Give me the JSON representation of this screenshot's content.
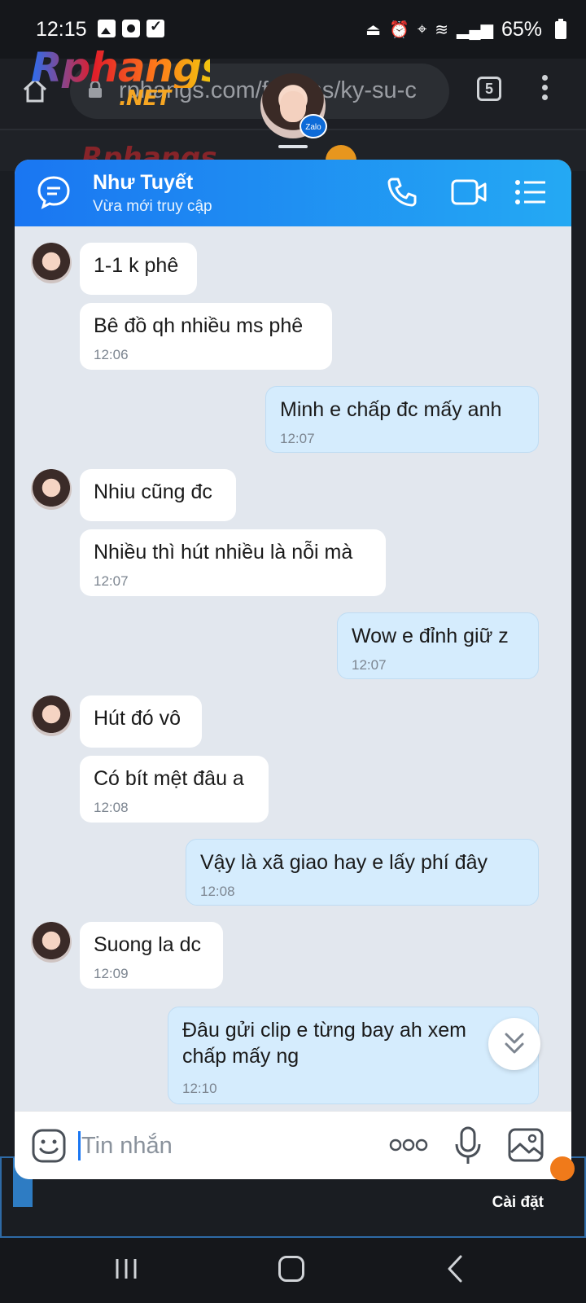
{
  "status_bar": {
    "time": "12:15",
    "battery": "65%"
  },
  "browser": {
    "url_visible": "rphangs.com/forums/ky-su-c",
    "tab_count": "5",
    "site_logo": "Rphangs",
    "site_logo_suffix": ".NET"
  },
  "chat": {
    "contact_name": "Như Tuyết",
    "contact_status": "Vừa mới truy cập",
    "badge": "Zalo",
    "messages": [
      {
        "dir": "in",
        "text": "1-1 k phê",
        "time": ""
      },
      {
        "dir": "in",
        "text": "Bê đồ qh nhiều ms phê",
        "time": "12:06"
      },
      {
        "dir": "out",
        "text": "Minh e chấp đc mấy  anh",
        "time": "12:07"
      },
      {
        "dir": "in",
        "text": "Nhiu cũng đc",
        "time": ""
      },
      {
        "dir": "in",
        "text": "Nhiều thì hút nhiều là nỗi mà",
        "time": "12:07"
      },
      {
        "dir": "out",
        "text": "Wow e đỉnh giữ  z",
        "time": "12:07"
      },
      {
        "dir": "in",
        "text": "Hút đó vô",
        "time": ""
      },
      {
        "dir": "in",
        "text": "Có bít mệt đâu a",
        "time": "12:08"
      },
      {
        "dir": "out",
        "text": "Vậy  là xã giao hay e lấy  phí  đây",
        "time": "12:08"
      },
      {
        "dir": "in",
        "text": "Suong la dc",
        "time": "12:09"
      },
      {
        "dir": "out",
        "text": "Đâu  gửi  clip e từng  bay ah xem",
        "text2": "chấp  mấy  ng",
        "time": "12:10"
      }
    ],
    "input_placeholder": "Tin nhắn"
  },
  "page_footer": {
    "settings_label": "Cài đặt"
  },
  "colors": {
    "header_gradient_start": "#1a76f2",
    "header_gradient_end": "#24a9f3",
    "bubble_in": "#ffffff",
    "bubble_out": "#d5ecfd",
    "chat_bg": "#e2e7ee"
  }
}
